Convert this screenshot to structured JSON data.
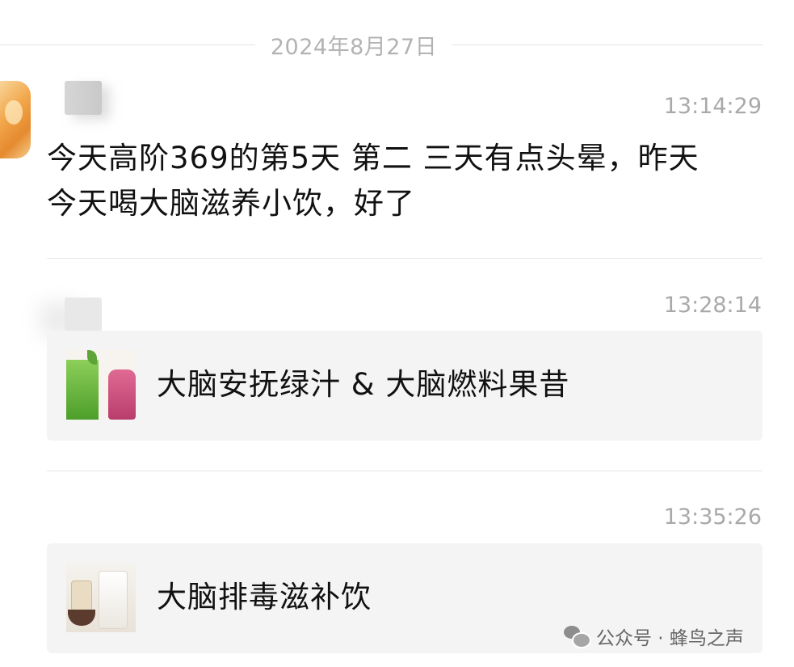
{
  "date_divider": "2024年8月27日",
  "messages": [
    {
      "time": "13:14:29",
      "text_line1": "今天高阶369的第5天 第二 三天有点头晕，昨天",
      "text_line2": "今天喝大脑滋养小饮，好了"
    },
    {
      "time": "13:28:14",
      "card_title": "大脑安抚绿汁 & 大脑燃料果昔"
    },
    {
      "time": "13:35:26",
      "card_title": "大脑排毒滋补饮"
    }
  ],
  "watermark": {
    "icon": "wechat-icon",
    "text": "公众号 · 蜂鸟之声"
  }
}
